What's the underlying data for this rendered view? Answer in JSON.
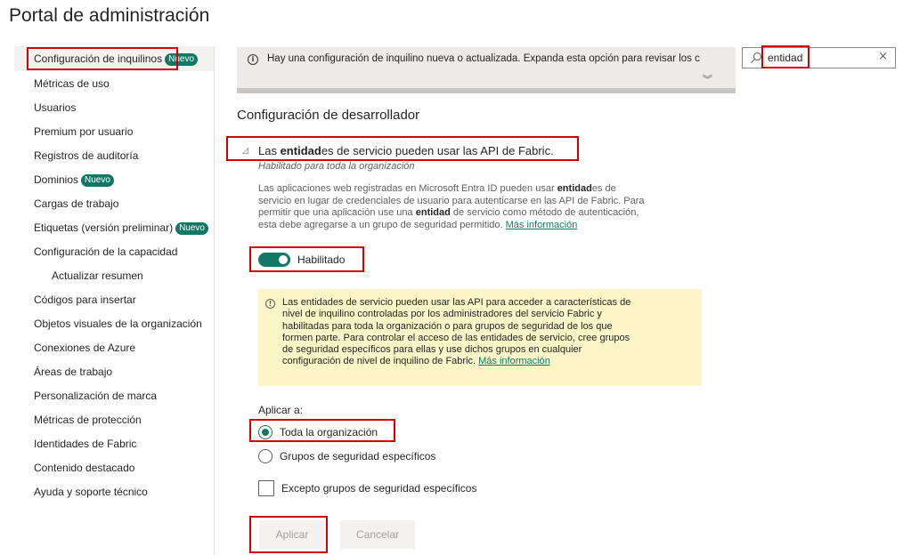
{
  "page": {
    "title": "Portal de administración"
  },
  "sidebar": {
    "items": [
      {
        "label": "Configuración de inquilinos",
        "badge": "Nuevo"
      },
      {
        "label": "Métricas de uso"
      },
      {
        "label": "Usuarios"
      },
      {
        "label": "Premium por usuario"
      },
      {
        "label": "Registros de auditoría"
      },
      {
        "label": "Dominios",
        "badge": "Nuevo"
      },
      {
        "label": "Cargas de trabajo"
      },
      {
        "label": "Etiquetas (versión preliminar)",
        "badge": "Nuevo"
      },
      {
        "label": "Configuración de la capacidad"
      },
      {
        "label": "Actualizar resumen"
      },
      {
        "label": "Códigos para insertar"
      },
      {
        "label": "Objetos visuales de la organización"
      },
      {
        "label": "Conexiones de Azure"
      },
      {
        "label": "Áreas de trabajo"
      },
      {
        "label": "Personalización de marca"
      },
      {
        "label": "Métricas de protección"
      },
      {
        "label": "Identidades de Fabric"
      },
      {
        "label": "Contenido destacado"
      },
      {
        "label": "Ayuda y soporte técnico"
      }
    ]
  },
  "banner": {
    "icon": "info-icon",
    "text": "Hay una configuración de inquilino nueva o actualizada. Expanda esta opción para revisar los c",
    "expand_glyph": "≫"
  },
  "search": {
    "value": "entidad",
    "clear_glyph": "×",
    "icon": "search-icon"
  },
  "section": {
    "title": "Configuración de desarrollador"
  },
  "setting": {
    "collapse_glyph": "◿",
    "title_bold": "entidad",
    "title_prefix": "Las ",
    "title_suffix": "es de servicio pueden usar las API de Fabric.",
    "subtitle": "Habilitado para toda la organización",
    "desc": {
      "l1_a": "Las aplicaciones web registradas en Microsoft Entra ID pueden usar ",
      "l1_bold": "entidad",
      "l1_b": "es de",
      "l2": "servicio en lugar de credenciales de usuario para autenticarse en las API de Fabric. Para",
      "l3_a": "permitir que una aplicación use una ",
      "l3_bold": "entidad",
      "l3_b": " de servicio como método de autenticación,",
      "l4": "esta debe agregarse a un grupo de seguridad permitido. ",
      "link": "Más información"
    },
    "toggle_label": "Habilitado",
    "toggle_on": true
  },
  "warning": {
    "lines": [
      "Las entidades de servicio pueden usar las API para acceder a características de",
      "nivel de inquilino controladas por los administradores del servicio Fabric y",
      "habilitadas para toda la organización o para grupos de seguridad de los que",
      "formen parte. Para controlar el acceso de las entidades de servicio, cree grupos",
      "de seguridad específicos para ellas y use dichos grupos en cualquier"
    ],
    "last_line": "configuración de nivel de inquilino de Fabric. ",
    "link": "Más información"
  },
  "apply": {
    "label": "Aplicar a:",
    "options": [
      "Toda la organización",
      "Grupos de seguridad específicos"
    ],
    "selected": "Toda la organización",
    "except_label": "Excepto grupos de seguridad específicos"
  },
  "buttons": {
    "apply": "Aplicar",
    "cancel": "Cancelar"
  },
  "colors": {
    "accent": "#117865",
    "highlight_box": "#d20000",
    "warning_bg": "#fbf5c7"
  }
}
